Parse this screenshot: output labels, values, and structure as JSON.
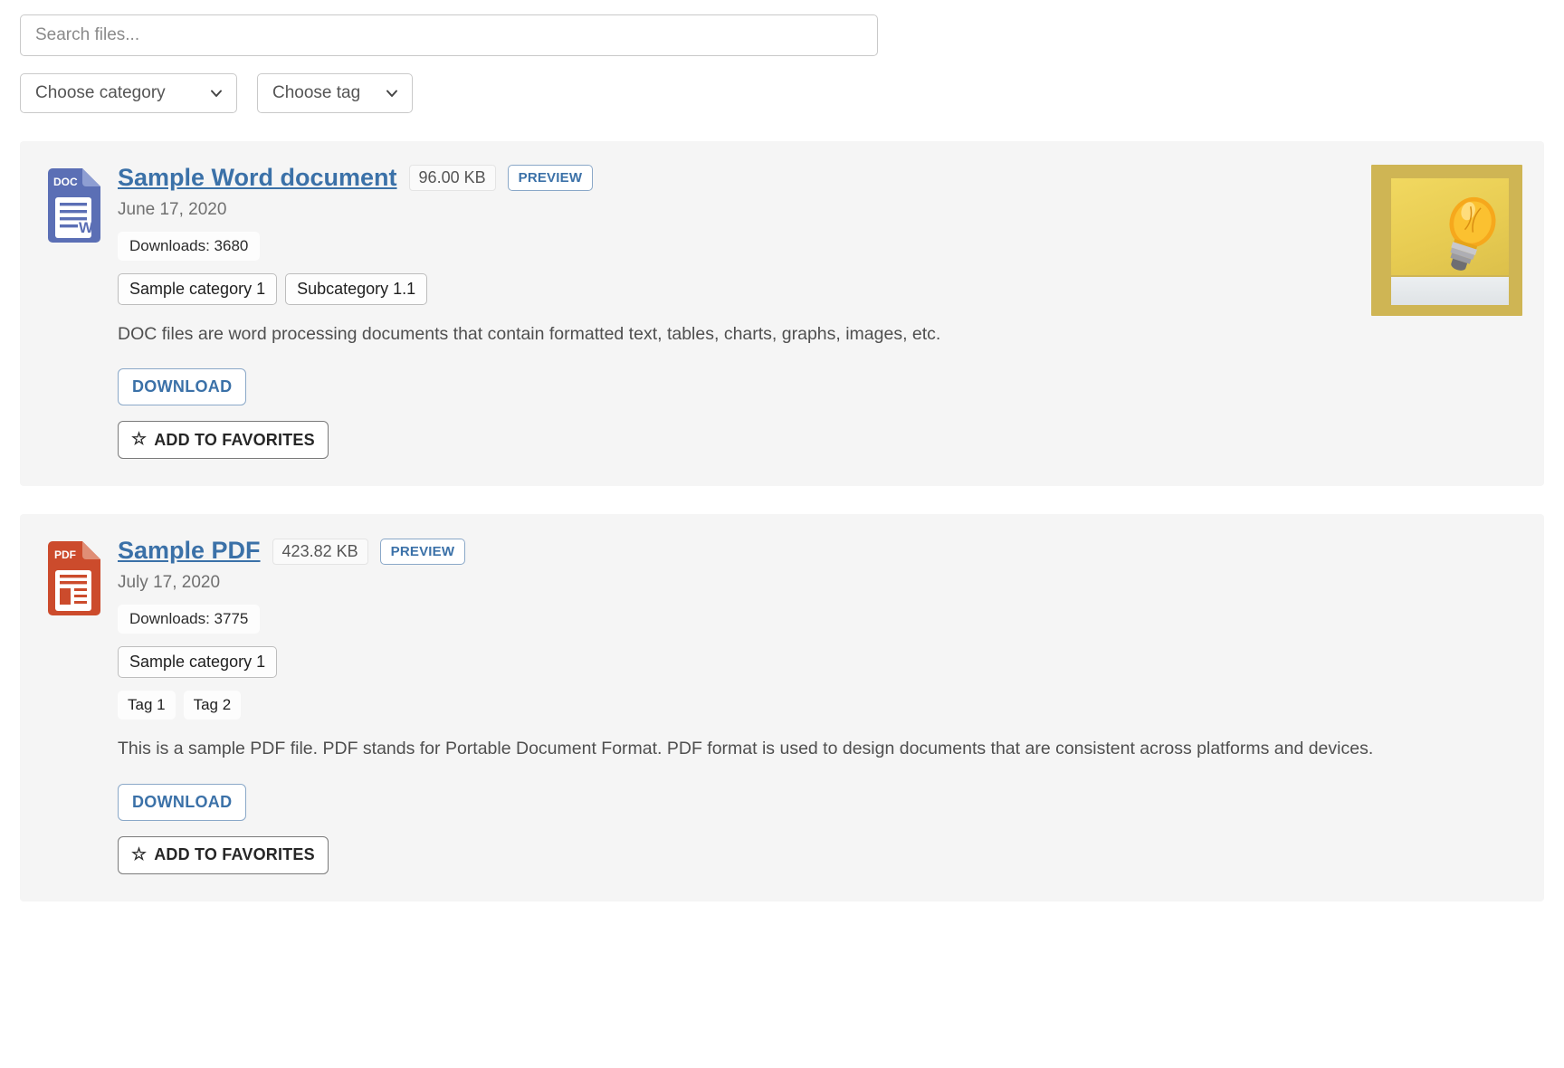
{
  "search": {
    "placeholder": "Search files...",
    "value": ""
  },
  "filters": [
    {
      "label": "Choose category",
      "icon": "chevron-down-icon"
    },
    {
      "label": "Choose tag",
      "icon": "chevron-down-icon"
    }
  ],
  "colors": {
    "link": "#3b71a8",
    "doc_icon": "#5b6fb5",
    "pdf_icon": "#cc4b2c",
    "card_bg": "#f5f5f5",
    "border": "#c9c9c9"
  },
  "files": [
    {
      "icon_label": "DOC",
      "icon_name": "doc-file-icon",
      "title": "Sample Word document",
      "size": "96.00 KB",
      "preview_label": "PREVIEW",
      "date": "June 17, 2020",
      "downloads": "Downloads: 3680",
      "categories": [
        "Sample category 1",
        "Subcategory 1.1"
      ],
      "tags": [],
      "description": "DOC files are word processing documents that contain formatted text, tables, charts, graphs, images, etc.",
      "download_label": "DOWNLOAD",
      "favorites_label": "ADD TO FAVORITES",
      "favorites_icon": "star-outline-icon",
      "thumbnail": "lightbulb-on-yellow-sticky-note"
    },
    {
      "icon_label": "PDF",
      "icon_name": "pdf-file-icon",
      "title": "Sample PDF",
      "size": "423.82 KB",
      "preview_label": "PREVIEW",
      "date": "July 17, 2020",
      "downloads": "Downloads: 3775",
      "categories": [
        "Sample category 1"
      ],
      "tags": [
        "Tag 1",
        "Tag 2"
      ],
      "description": "This is a sample PDF file. PDF stands for Portable Document Format. PDF format is used to design documents that are consistent across platforms and devices.",
      "download_label": "DOWNLOAD",
      "favorites_label": "ADD TO FAVORITES",
      "favorites_icon": "star-outline-icon",
      "thumbnail": null
    }
  ]
}
